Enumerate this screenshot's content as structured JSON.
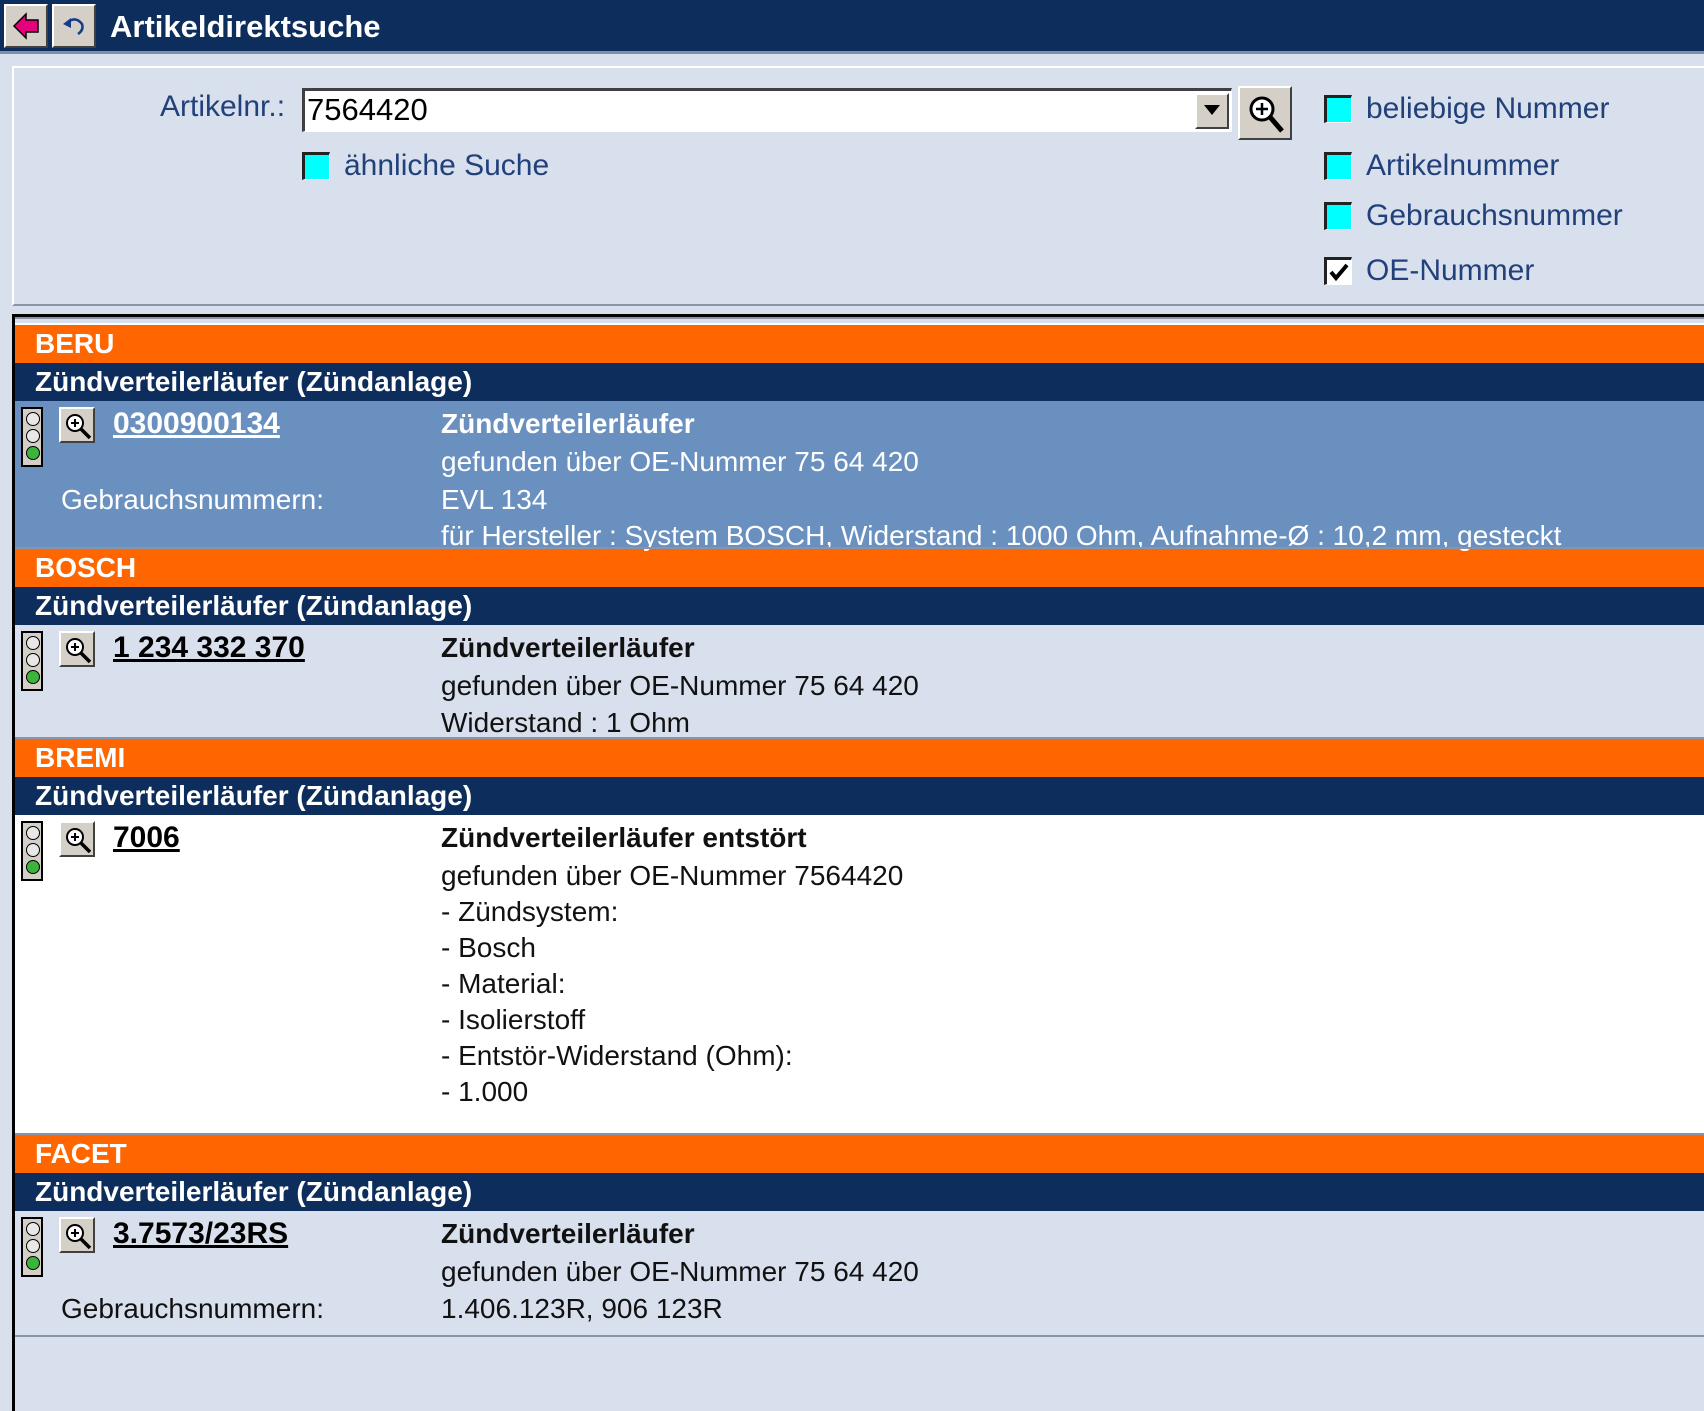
{
  "title": "Artikeldirektsuche",
  "search": {
    "label": "Artikelnr.:",
    "value": "7564420",
    "similar_label": "ähnliche Suche",
    "options": [
      {
        "label": "beliebige Nummer",
        "checked": false
      },
      {
        "label": "Artikelnummer",
        "checked": false
      },
      {
        "label": "Gebrauchsnummer",
        "checked": false
      },
      {
        "label": "OE-Nummer",
        "checked": true
      }
    ]
  },
  "results": [
    {
      "brand": "BERU",
      "group": "Zündverteilerläufer (Zündanlage)",
      "article_number": "0300900134",
      "name": "Zündverteilerläufer",
      "lines": [
        "gefunden über OE-Nummer 75 64 420",
        "EVL 134",
        "für Hersteller : System BOSCH, Widerstand : 1000 Ohm, Aufnahme-Ø : 10,2 mm, gesteckt"
      ],
      "usage_label": "Gebrauchsnummern:",
      "selected": true
    },
    {
      "brand": "BOSCH",
      "group": "Zündverteilerläufer (Zündanlage)",
      "article_number": "1 234 332 370",
      "name": "Zündverteilerläufer",
      "lines": [
        "gefunden über OE-Nummer 75 64 420",
        "Widerstand : 1 Ohm"
      ]
    },
    {
      "brand": "BREMI",
      "group": "Zündverteilerläufer (Zündanlage)",
      "article_number": "7006",
      "name": "Zündverteilerläufer entstört",
      "lines": [
        "gefunden über OE-Nummer 7564420",
        "- Zündsystem:",
        "- Bosch",
        "- Material:",
        "- Isolierstoff",
        "- Entstör-Widerstand (Ohm):",
        "- 1.000"
      ]
    },
    {
      "brand": "FACET",
      "group": "Zündverteilerläufer (Zündanlage)",
      "article_number": "3.7573/23RS",
      "name": "Zündverteilerläufer",
      "lines": [
        "gefunden über OE-Nummer 75 64 420",
        "1.406.123R, 906 123R"
      ],
      "usage_label": "Gebrauchsnummern:"
    }
  ]
}
